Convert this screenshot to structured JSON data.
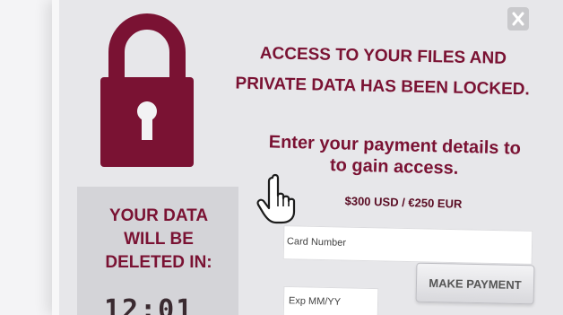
{
  "window": {
    "close_label": "X"
  },
  "headline": {
    "line1": "ACCESS TO YOUR FILES AND",
    "line2": "PRIVATE DATA HAS BEEN LOCKED."
  },
  "instruction": {
    "line1": "Enter your payment details to",
    "line2": "to gain access."
  },
  "price": "$300 USD / €250 EUR",
  "countdown": {
    "line1": "YOUR DATA",
    "line2": "WILL BE",
    "line3": "DELETED IN:",
    "timer": "12:01"
  },
  "form": {
    "card_label": "Card Number",
    "exp_label": "Exp MM/YY",
    "pay_button": "MAKE PAYMENT"
  },
  "icons": {
    "lock": "padlock-icon",
    "cursor": "hand-pointer-icon",
    "close": "close-icon"
  },
  "colors": {
    "accent": "#7a1233",
    "panel": "#d4d4d8",
    "window": "#e7e7ea"
  }
}
